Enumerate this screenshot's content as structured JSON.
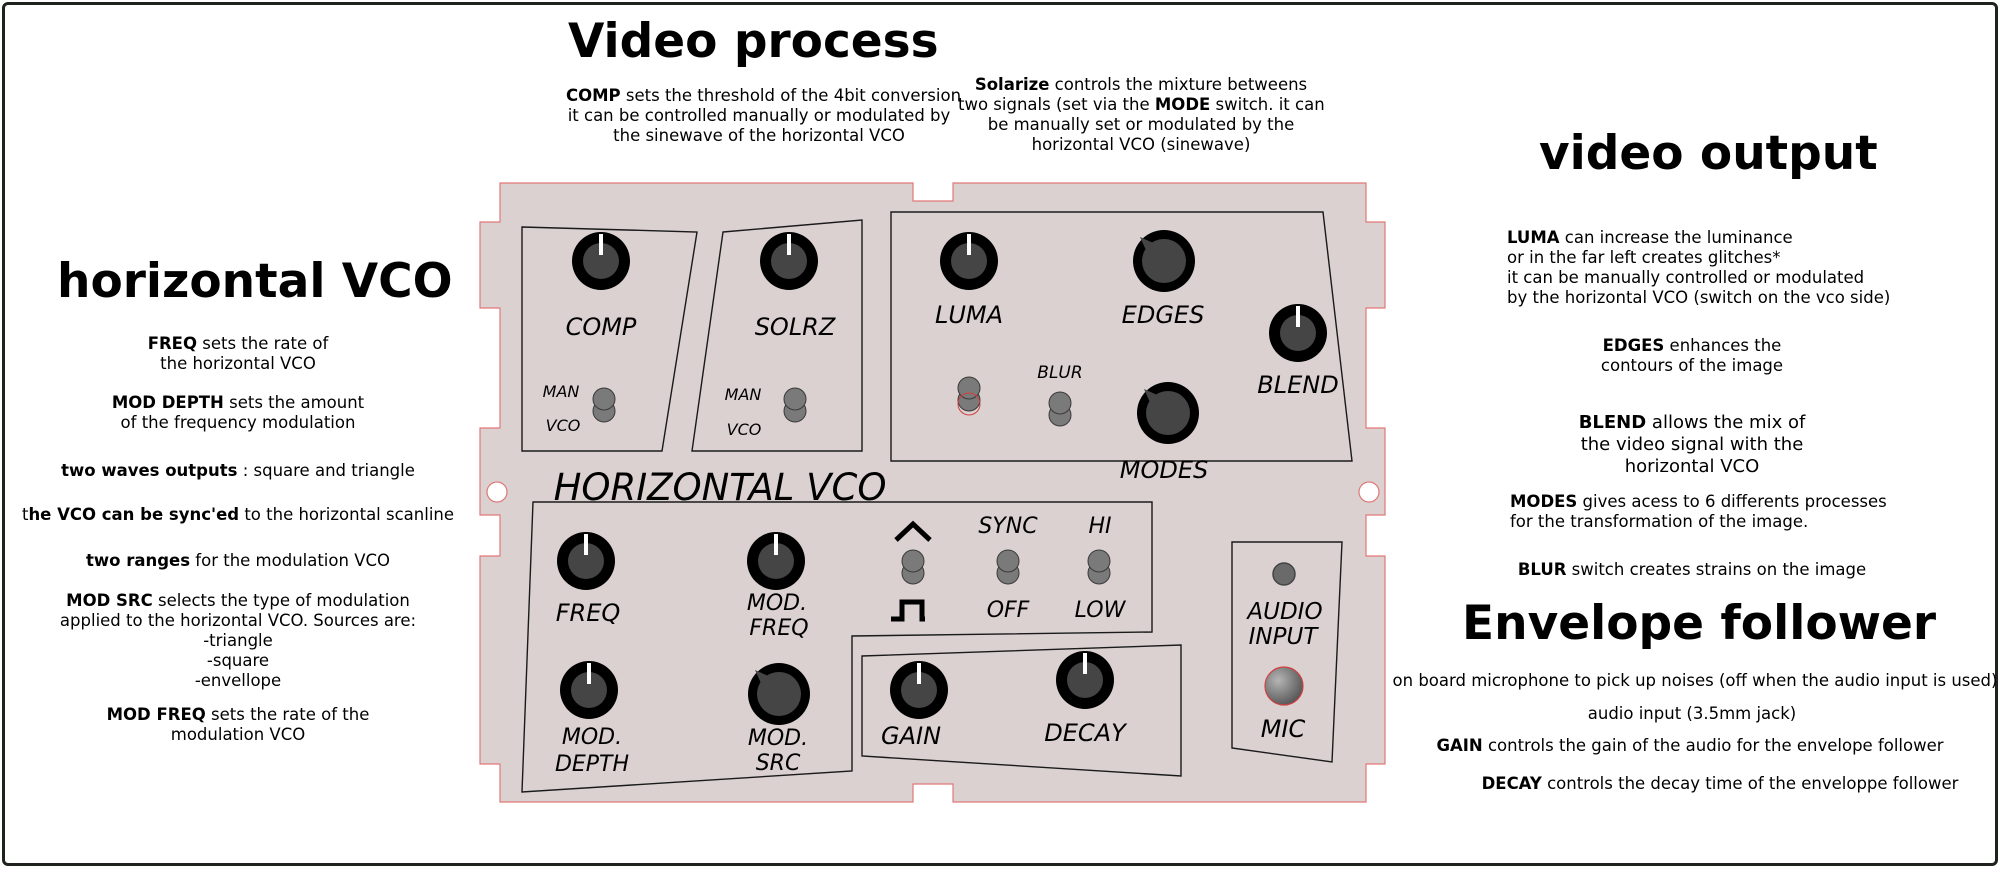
{
  "headings": {
    "video_process": "Video process",
    "horizontal_vco": "horizontal VCO",
    "video_output": "video output",
    "envelope_follower": "Envelope follower"
  },
  "notes": {
    "comp": {
      "b": "COMP",
      "l1": " sets the threshold of the 4bit conversion",
      "l2": "it can be controlled manually or modulated by",
      "l3": "the sinewave of the horizontal VCO"
    },
    "solarize": {
      "b1": "Solarize",
      "l1": " controls the mixture betweens",
      "l2a": "two signals (set via the ",
      "b2": "MODE",
      "l2b": " switch. it can",
      "l3": "be manually set or modulated by the",
      "l4": "horizontal VCO (sinewave)"
    },
    "freq": {
      "b": "FREQ",
      "l1": " sets the rate of",
      "l2": "the horizontal VCO"
    },
    "mod_depth": {
      "b": "MOD DEPTH",
      "l1": " sets the amount",
      "l2": "of the frequency modulation"
    },
    "waves": {
      "b": "two waves outputs",
      "l1": " : square and triangle"
    },
    "sync": {
      "a": "t",
      "b": "he VCO can be sync'ed",
      "l1": " to the horizontal scanline"
    },
    "ranges": {
      "b": "two ranges",
      "l1": " for the modulation VCO"
    },
    "mod_src": {
      "b": "MOD SRC",
      "l1": " selects the type of modulation",
      "l2": "applied to the horizontal VCO. Sources are:",
      "l3": "-triangle",
      "l4": "-square",
      "l5": "-envellope"
    },
    "mod_freq": {
      "b": "MOD FREQ",
      "l1": " sets the rate of the",
      "l2": "modulation VCO"
    },
    "luma": {
      "b": "LUMA",
      "l1": " can increase the luminance",
      "l2": "or in the far left creates glitches*",
      "l3": "it can be manually controlled or modulated",
      "l4": "by the horizontal VCO (switch on the vco side)"
    },
    "edges": {
      "b": "EDGES",
      "l1": " enhances the",
      "l2": "contours of the image"
    },
    "blend": {
      "b": "BLEND",
      "l1": " allows the mix of",
      "l2": "the video signal with the",
      "l3": "horizontal VCO"
    },
    "modes": {
      "b": "MODES",
      "l1": " gives acess to 6 differents processes",
      "l2": "for the transformation of the image."
    },
    "blur": {
      "b": "BLUR",
      "l1": " switch creates strains on the image"
    },
    "mic": {
      "l1": "on board microphone to pick up noises (off when the audio input is used)"
    },
    "audio_in": {
      "l1": "audio input (3.5mm jack)"
    },
    "gain": {
      "b": "GAIN",
      "l1": " controls the gain of the audio for the envelope follower"
    },
    "decay": {
      "b": "DECAY",
      "l1": " controls the decay time of the enveloppe follower"
    }
  },
  "panel": {
    "section_title": "HORIZONTAL VCO",
    "labels": {
      "comp": "COMP",
      "solrz": "SOLRZ",
      "man1": "MAN",
      "vco1": "VCO",
      "man2": "MAN",
      "vco2": "VCO",
      "luma": "LUMA",
      "edges": "EDGES",
      "blend": "BLEND",
      "blur": "BLUR",
      "modes": "MODES",
      "freq": "FREQ",
      "mod_freq_1": "MOD.",
      "mod_freq_2": "FREQ",
      "sync": "SYNC",
      "off": "OFF",
      "hi": "HI",
      "low": "LOW",
      "mod_depth_1": "MOD.",
      "mod_depth_2": "DEPTH",
      "mod_src_1": "MOD.",
      "mod_src_2": "SRC",
      "gain": "GAIN",
      "decay": "DECAY",
      "audio_1": "AUDIO",
      "audio_2": "INPUT",
      "mic": "MIC"
    },
    "knob_positions_deg": {
      "comp": 0,
      "solrz": 0,
      "luma": 0,
      "edges": -45,
      "blend": 0,
      "modes": -45,
      "freq": 0,
      "mod_freq": 0,
      "mod_depth": 0,
      "mod_src": -45,
      "gain": 0,
      "decay": 0
    },
    "colors": {
      "panel": "#dbd1d1",
      "panel_edge": "#e07878",
      "knob": "#000000",
      "knob_cap": "#454545",
      "toggle": "#7a7a7a"
    }
  }
}
